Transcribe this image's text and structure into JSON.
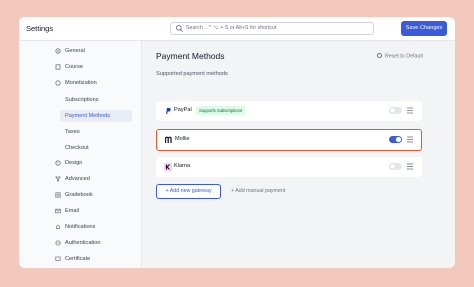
{
  "app": {
    "title": "Settings"
  },
  "search": {
    "placeholder": "Search ...^ ⌥ + S or Alt+S for shortcut"
  },
  "header": {
    "save_label": "Save Changes"
  },
  "sidebar": {
    "items": [
      {
        "label": "General",
        "icon": "gear-icon"
      },
      {
        "label": "Course",
        "icon": "book-icon"
      },
      {
        "label": "Monetization",
        "icon": "coin-icon"
      },
      {
        "label": "Subscriptions"
      },
      {
        "label": "Payment Methods",
        "active": true
      },
      {
        "label": "Taxes"
      },
      {
        "label": "Checkout"
      },
      {
        "label": "Design",
        "icon": "palette-icon"
      },
      {
        "label": "Advanced",
        "icon": "filter-icon"
      },
      {
        "label": "Gradebook",
        "icon": "grid-icon"
      },
      {
        "label": "Email",
        "icon": "mail-icon"
      },
      {
        "label": "Notifications",
        "icon": "bell-icon"
      },
      {
        "label": "Authentication",
        "icon": "globe-icon"
      },
      {
        "label": "Certificate",
        "icon": "certificate-icon"
      }
    ]
  },
  "main": {
    "title": "Payment Methods",
    "reset_label": "Reset to Default",
    "subtitle": "Supported payment methods",
    "gateways": [
      {
        "name": "PayPal",
        "badge": "Supports Subscriptions",
        "enabled": false,
        "icon": "paypal-icon"
      },
      {
        "name": "Mollie",
        "enabled": true,
        "highlighted": true,
        "icon": "mollie-icon"
      },
      {
        "name": "Klarna",
        "enabled": false,
        "icon": "klarna-icon"
      }
    ],
    "add_gateway_label": "+ Add new gateway",
    "add_manual_label": "+ Add manual payment"
  },
  "colors": {
    "accent": "#3b5bdb",
    "highlight": "#e35b35",
    "badge_bg": "#dcfce7",
    "background": "#f4c9bd"
  }
}
